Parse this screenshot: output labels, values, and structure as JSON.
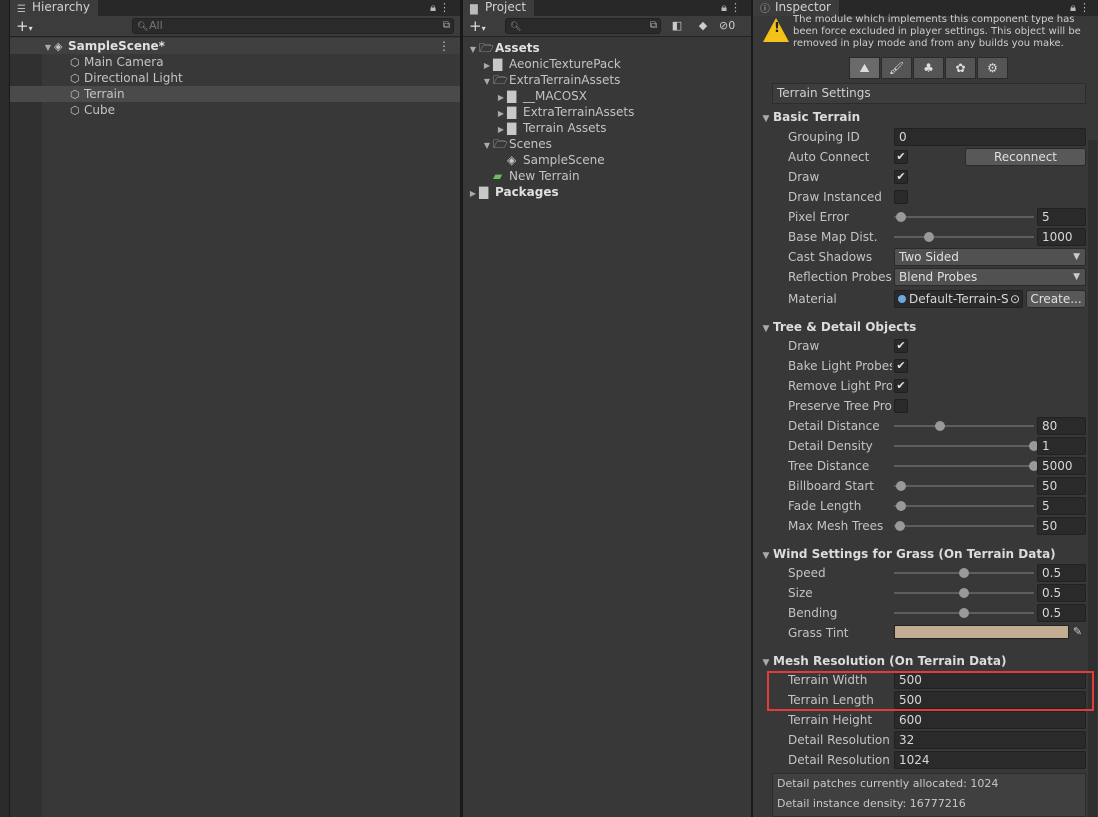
{
  "hierarchy": {
    "title": "Hierarchy",
    "search_placeholder": "All",
    "scene": "SampleScene*",
    "items": [
      "Main Camera",
      "Directional Light",
      "Terrain",
      "Cube"
    ]
  },
  "project": {
    "title": "Project",
    "hidden_count": "0",
    "tree": [
      {
        "label": "Assets",
        "depth": 0,
        "bold": true
      },
      {
        "label": "AeonicTexturePack",
        "depth": 1
      },
      {
        "label": "ExtraTerrainAssets",
        "depth": 1
      },
      {
        "label": "__MACOSX",
        "depth": 2
      },
      {
        "label": "ExtraTerrainAssets",
        "depth": 2
      },
      {
        "label": "Terrain Assets",
        "depth": 2
      },
      {
        "label": "Scenes",
        "depth": 1
      },
      {
        "label": "SampleScene",
        "depth": 2
      },
      {
        "label": "New Terrain",
        "depth": 1
      },
      {
        "label": "Packages",
        "depth": 0,
        "bold": true
      }
    ]
  },
  "inspector": {
    "title": "Inspector",
    "warning": "The module which implements this component type has been force excluded in player settings. This object will be removed in play mode and from any builds you make.",
    "settings_title": "Terrain Settings",
    "basic": {
      "header": "Basic Terrain",
      "grouping_id_label": "Grouping ID",
      "grouping_id": "0",
      "auto_connect_label": "Auto Connect",
      "reconnect": "Reconnect",
      "draw_label": "Draw",
      "draw_instanced_label": "Draw Instanced",
      "pixel_error_label": "Pixel Error",
      "pixel_error": "5",
      "base_map_label": "Base Map Dist.",
      "base_map": "1000",
      "cast_shadows_label": "Cast Shadows",
      "cast_shadows": "Two Sided",
      "reflection_label": "Reflection Probes",
      "reflection": "Blend Probes",
      "material_label": "Material",
      "material": "Default-Terrain-S",
      "create": "Create..."
    },
    "tree": {
      "header": "Tree & Detail Objects",
      "draw_label": "Draw",
      "bake_label": "Bake Light Probes",
      "remove_label": "Remove Light Probe",
      "preserve_label": "Preserve Tree Prot",
      "detail_distance_label": "Detail Distance",
      "detail_distance": "80",
      "detail_density_label": "Detail Density",
      "detail_density": "1",
      "tree_distance_label": "Tree Distance",
      "tree_distance": "5000",
      "billboard_label": "Billboard Start",
      "billboard": "50",
      "fade_label": "Fade Length",
      "fade": "5",
      "max_mesh_label": "Max Mesh Trees",
      "max_mesh": "50"
    },
    "wind": {
      "header": "Wind Settings for Grass (On Terrain Data)",
      "speed_label": "Speed",
      "speed": "0.5",
      "size_label": "Size",
      "size": "0.5",
      "bending_label": "Bending",
      "bending": "0.5",
      "tint_label": "Grass Tint",
      "tint_color": "#c2ad93"
    },
    "mesh": {
      "header": "Mesh Resolution (On Terrain Data)",
      "width_label": "Terrain Width",
      "width": "500",
      "length_label": "Terrain Length",
      "length": "500",
      "height_label": "Terrain Height",
      "height": "600",
      "detail_res_patch_label": "Detail Resolution P",
      "detail_res_patch": "32",
      "detail_res_label": "Detail Resolution",
      "detail_res": "1024"
    },
    "info": {
      "patches": "Detail patches currently allocated: 1024",
      "density": "Detail instance density: 16777216"
    }
  },
  "colors": {
    "highlight": "#e33a3a",
    "warning": "#f2c21a"
  },
  "sliders": {
    "pixel_error": 0.05,
    "base_map": 0.25,
    "detail_distance": 0.33,
    "detail_density": 1.0,
    "tree_distance": 1.0,
    "billboard": 0.05,
    "fade": 0.05,
    "max_mesh": 0.04,
    "speed": 0.5,
    "size": 0.5,
    "bending": 0.5
  }
}
